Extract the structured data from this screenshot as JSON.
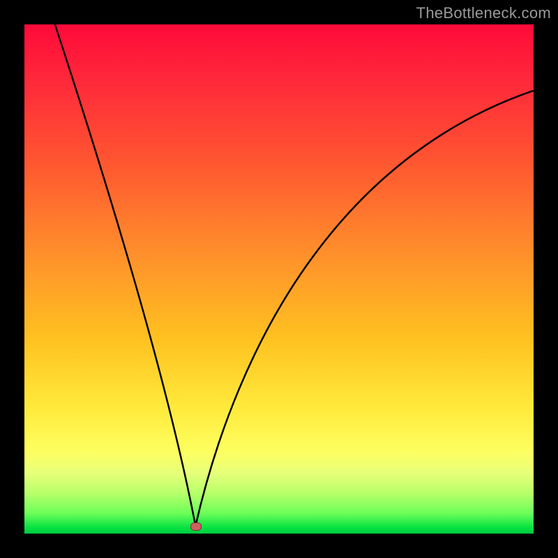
{
  "watermark": "TheBottleneck.com",
  "marker": {
    "x_frac": 0.336,
    "y_frac": 0.985
  },
  "curve": {
    "left": {
      "start": {
        "x_frac": 0.06,
        "y_frac": 0.0
      },
      "ctrl": {
        "x_frac": 0.27,
        "y_frac": 0.64
      },
      "end": {
        "x_frac": 0.336,
        "y_frac": 0.985
      }
    },
    "right": {
      "start": {
        "x_frac": 0.336,
        "y_frac": 0.985
      },
      "ctrl1": {
        "x_frac": 0.42,
        "y_frac": 0.62
      },
      "ctrl2": {
        "x_frac": 0.62,
        "y_frac": 0.26
      },
      "end": {
        "x_frac": 1.0,
        "y_frac": 0.13
      }
    }
  },
  "chart_data": {
    "type": "line",
    "title": "",
    "xlabel": "",
    "ylabel": "",
    "xlim": [
      0,
      100
    ],
    "ylim": [
      0,
      100
    ],
    "x": [
      6,
      12,
      18,
      24,
      29,
      31,
      33,
      34,
      36,
      40,
      45,
      52,
      60,
      70,
      80,
      90,
      100
    ],
    "y": [
      100,
      80,
      60,
      40,
      20,
      10,
      2,
      0,
      4,
      22,
      40,
      55,
      66,
      75,
      81,
      85,
      87
    ],
    "min_point": {
      "x": 34,
      "y": 0
    },
    "annotations": [
      "TheBottleneck.com"
    ]
  }
}
